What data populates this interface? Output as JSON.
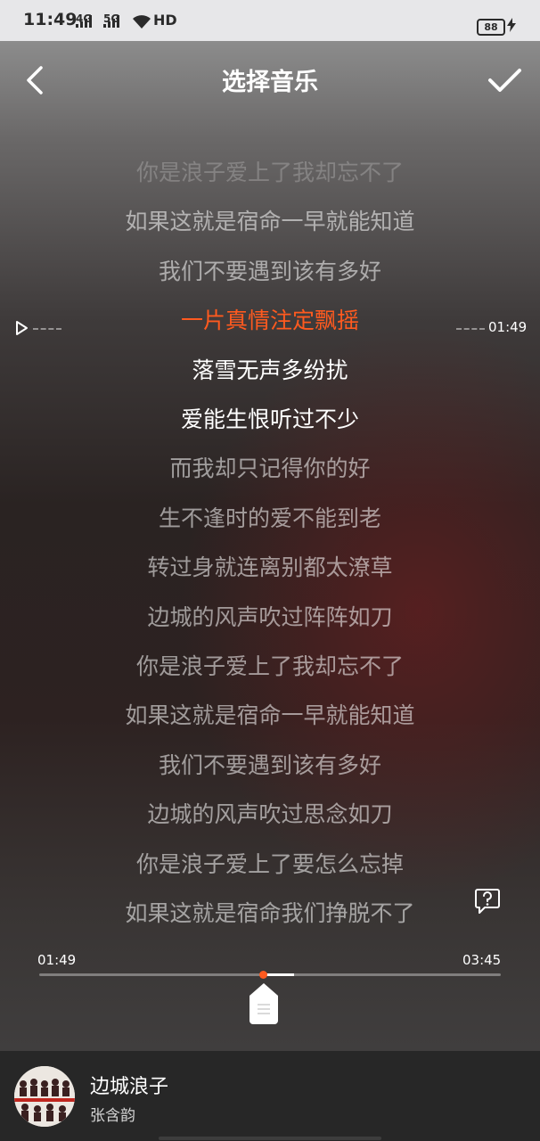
{
  "status_bar": {
    "time": "11:49",
    "network_1": "4G",
    "network_2": "5G",
    "wifi_label": "HD",
    "battery": "88"
  },
  "header": {
    "title": "选择音乐",
    "back_icon": "chevron-left-icon",
    "confirm_icon": "checkmark-icon"
  },
  "lyrics": [
    "你是浪子爱上了我却忘不了",
    "如果这就是宿命一早就能知道",
    "我们不要遇到该有多好",
    "一片真情注定飘摇",
    "落雪无声多纷扰",
    "爱能生恨听过不少",
    "而我却只记得你的好",
    "生不逢时的爱不能到老",
    "转过身就连离别都太潦草",
    "边城的风声吹过阵阵如刀",
    "你是浪子爱上了我却忘不了",
    "如果这就是宿命一早就能知道",
    "我们不要遇到该有多好",
    "边城的风声吹过思念如刀",
    "你是浪子爱上了要怎么忘掉",
    "如果这就是宿命我们挣脱不了"
  ],
  "current_line_index": 3,
  "seek_time": "01:49",
  "player": {
    "current_time": "01:49",
    "total_time": "03:45",
    "progress": 0.484,
    "selection_end": 0.552
  },
  "song": {
    "title": "边城浪子",
    "artist": "张含韵"
  },
  "colors": {
    "accent": "#ff5a1f",
    "bottom_bar": "#272727"
  }
}
